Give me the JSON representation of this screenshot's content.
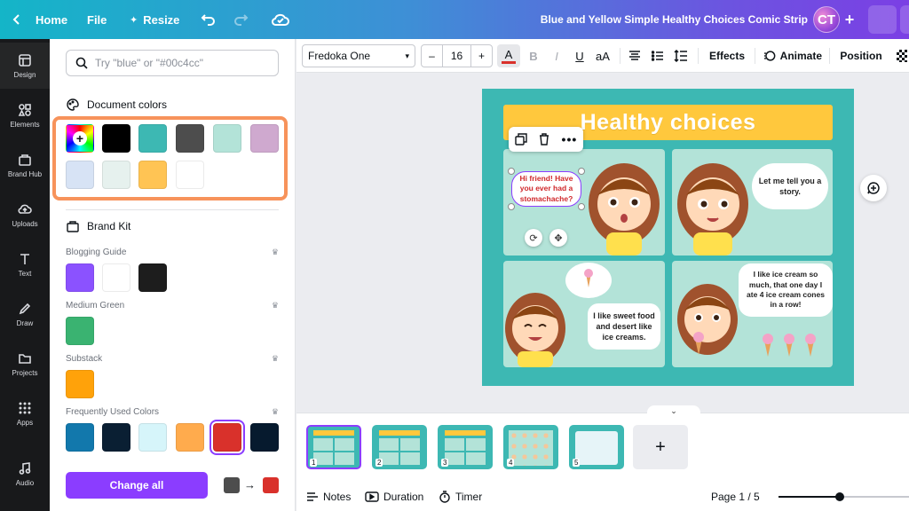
{
  "topbar": {
    "home_label": "Home",
    "file_label": "File",
    "resize_label": "Resize",
    "doc_title": "Blue and Yellow Simple Healthy Choices Comic Strip",
    "avatar_initials": "CT",
    "plus_label": "+"
  },
  "rail": {
    "items": [
      {
        "label": "Design",
        "icon": "design-icon"
      },
      {
        "label": "Elements",
        "icon": "elements-icon"
      },
      {
        "label": "Brand Hub",
        "icon": "brand-hub-icon"
      },
      {
        "label": "Uploads",
        "icon": "uploads-icon"
      },
      {
        "label": "Text",
        "icon": "text-icon"
      },
      {
        "label": "Draw",
        "icon": "draw-icon"
      },
      {
        "label": "Projects",
        "icon": "projects-icon"
      },
      {
        "label": "Apps",
        "icon": "apps-icon"
      },
      {
        "label": "Audio",
        "icon": "audio-icon"
      }
    ]
  },
  "panel": {
    "search_placeholder": "Try \"blue\" or \"#00c4cc\"",
    "document_colors_title": "Document colors",
    "document_colors": [
      "#000000",
      "#3db8b3",
      "#4d4d4d",
      "#b3e3d8",
      "#cfa9cf",
      "#d7e3f5",
      "#e6f1ee",
      "#ffc454",
      "#ffffff"
    ],
    "brand_kit_title": "Brand Kit",
    "groups": [
      {
        "name": "Blogging Guide",
        "colors": [
          "#8b52ff",
          "#ffffff",
          "#1d1d1d"
        ]
      },
      {
        "name": "Medium Green",
        "colors": [
          "#3ab371"
        ]
      },
      {
        "name": "Substack",
        "colors": [
          "#ffa20a"
        ]
      },
      {
        "name": "Frequently Used Colors",
        "colors": [
          "#1278ac",
          "#0a1f33",
          "#d6f5fa",
          "#ffab4d",
          "#d9312b",
          "#061a2e"
        ]
      }
    ],
    "change_all_label": "Change all",
    "change_from": "#4d4d4d",
    "change_to": "#d9312b",
    "arrow_glyph": "→"
  },
  "toolbar": {
    "font_name": "Fredoka One",
    "minus": "–",
    "font_size": "16",
    "plus": "+",
    "bold": "B",
    "italic": "I",
    "underline": "U",
    "case": "aA",
    "effects_label": "Effects",
    "animate_label": "Animate",
    "position_label": "Position",
    "text_color": "#d9312b"
  },
  "canvas": {
    "title": "Healthy choices",
    "bubble1": "Hi friend! Have you ever had a stomachache?",
    "bubble2": "Let me tell you a story.",
    "bubble3": "I like sweet food and desert like ice creams.",
    "bubble4": "I like ice cream so much, that one day I ate 4 ice cream cones in a row!"
  },
  "filmstrip": {
    "pages": [
      "1",
      "2",
      "3",
      "4",
      "5"
    ],
    "add_label": "+",
    "collapse_glyph": "⌄"
  },
  "footer": {
    "notes_label": "Notes",
    "duration_label": "Duration",
    "timer_label": "Timer",
    "page_indicator": "Page 1 / 5"
  }
}
